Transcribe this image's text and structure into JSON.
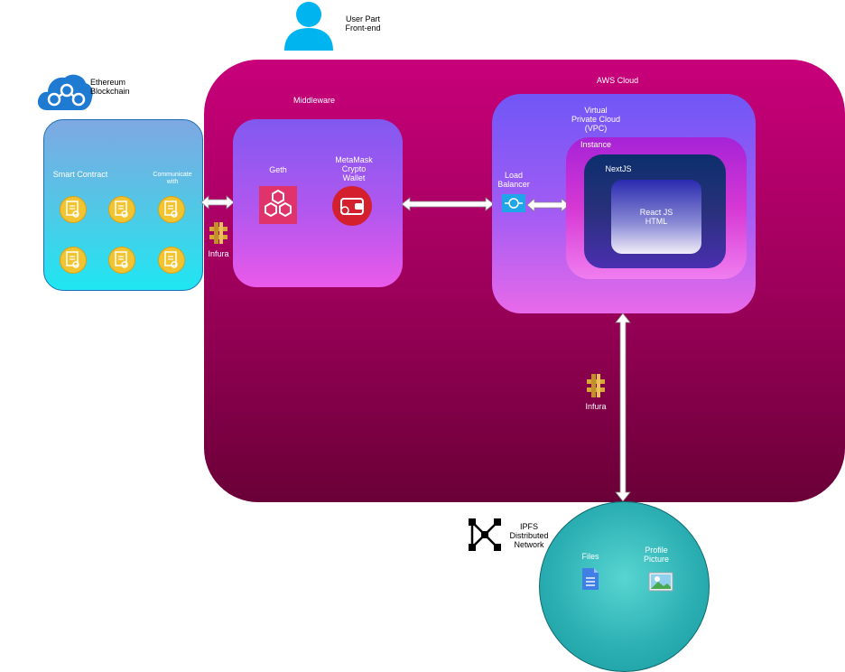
{
  "user": {
    "label_line1": "User Part",
    "label_line2": "Front-end"
  },
  "ethereum": {
    "label_line1": "Ethereum",
    "label_line2": "Blockchain"
  },
  "blockchain_box": {
    "smart_contract": "Smart Contract",
    "communicate": "Communicate\nwith"
  },
  "infura_left": "Infura",
  "infura_center": "Infura",
  "aws": {
    "label": "AWS Cloud"
  },
  "middleware": {
    "label": "Middleware",
    "geth": "Geth",
    "metamask": "MetaMask\nCrypto\nWallet"
  },
  "vpc": {
    "label": "Virtual\nPrivate Cloud\n(VPC)",
    "load_balancer": "Load\nBalancer"
  },
  "instance": {
    "label": "Instance"
  },
  "nextjs": {
    "label": "NextJS"
  },
  "react": {
    "label": "React JS\nHTML"
  },
  "ipfs": {
    "label": "IPFS\nDistributed\nNetwork",
    "files": "Files",
    "profile": "Profile\nPicture"
  },
  "colors": {
    "aws_top": "#c8007a",
    "aws_bottom": "#6a0037",
    "token": "#f2c430",
    "user_icon": "#00b4ef",
    "ethereum_icon": "#1f7bd1"
  }
}
